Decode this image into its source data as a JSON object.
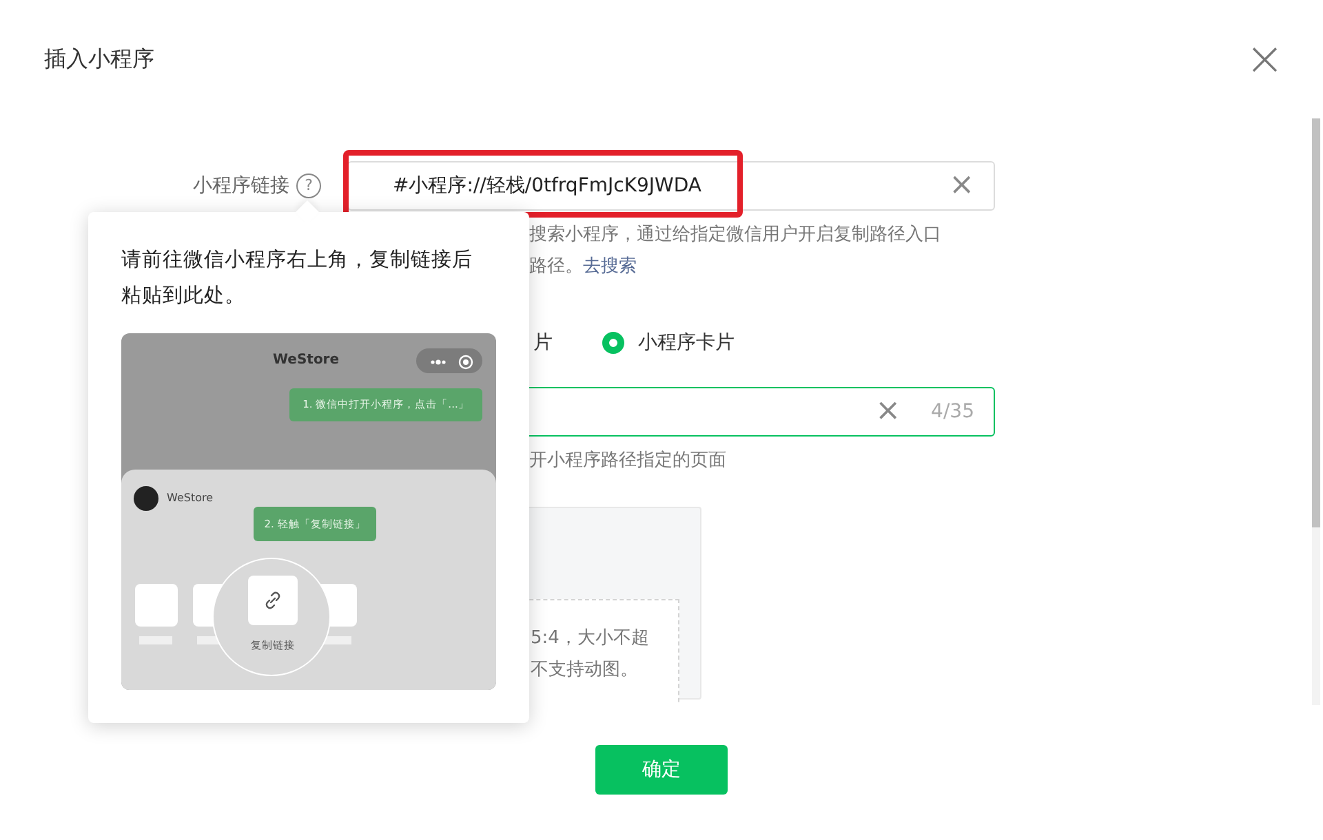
{
  "dialog": {
    "title": "插入小程序",
    "close": "×"
  },
  "form": {
    "link_field": {
      "label": "小程序链接",
      "help": "?",
      "value": "#小程序://轻栈/0tfrqFmJcK9JWDA",
      "clear": "×",
      "highlighted": true
    },
    "link_hint": {
      "line_1": "搜索小程序，通过给指定微信用户开启复制路径入口",
      "line_2": "路径。",
      "link": "去搜索"
    },
    "display_options": [
      {
        "label": "片",
        "selected": false
      },
      {
        "label": "小程序卡片",
        "selected": true
      }
    ],
    "title_field": {
      "clear": "×",
      "counter": "4/35",
      "focused": true
    },
    "title_hint": "开小程序路径指定的页面",
    "cover_upload": {
      "line_1": "5:4，大小不超",
      "line_2": "不支持动图。"
    }
  },
  "popover": {
    "text": "请前往微信小程序右上角，复制链接后粘贴到此处。",
    "guide": {
      "app_name": "WeStore",
      "step_1": "1. 微信中打开小程序，点击「...」",
      "sheet_app_name": "WeStore",
      "step_2": "2. 轻触「复制链接」",
      "action_label": "复制链接"
    }
  },
  "footer": {
    "confirm": "确定"
  }
}
